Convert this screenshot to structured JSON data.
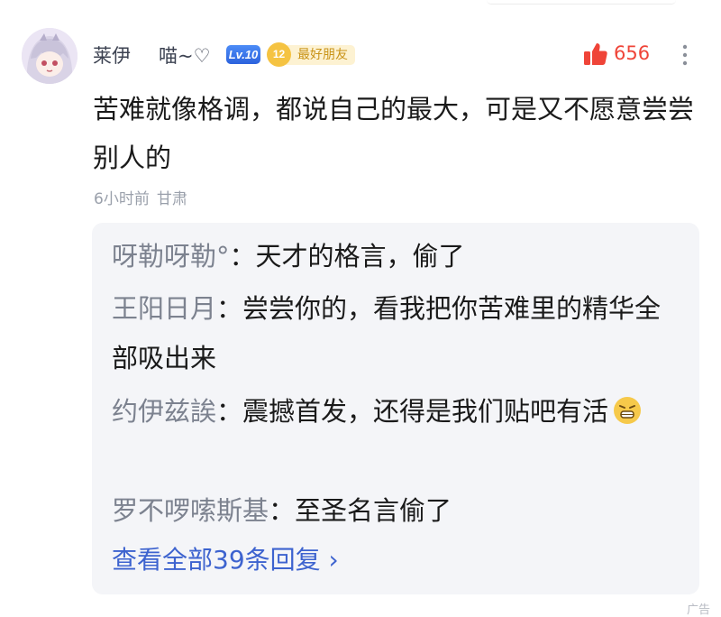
{
  "comment": {
    "username": "莱伊",
    "nickname": "喵~♡",
    "level": "Lv.10",
    "badge_number": "12",
    "badge_label": "最好朋友",
    "likes": "656",
    "text": "苦难就像格调，都说自己的最大，可是又不愿意尝尝别人的",
    "time": "6小时前",
    "location": "甘肃"
  },
  "replies": [
    {
      "name": "呀勒呀勒°",
      "sep": "：",
      "text": "天才的格言，偷了"
    },
    {
      "name": "王阳日月",
      "sep": "：",
      "text": "尝尝你的，看我把你苦难里的精华全部吸出来"
    },
    {
      "name": "约伊兹誒",
      "sep": "：",
      "text": "震撼首发，还得是我们贴吧有活"
    },
    {
      "name": "罗不啰嗦斯基",
      "sep": "：",
      "text": "至圣名言偷了"
    }
  ],
  "view_all": "查看全部39条回复 ›",
  "ad_label": "广告",
  "colors": {
    "like": "#ef4438",
    "link": "#3d63cf",
    "reply_name": "#7c828f",
    "level_badge": "#2c62dd"
  },
  "icons": [
    "avatar",
    "level-badge",
    "best-friend-badge-icon",
    "thumbs-up-icon",
    "more-vertical-icon",
    "grinning-emoji-icon"
  ]
}
